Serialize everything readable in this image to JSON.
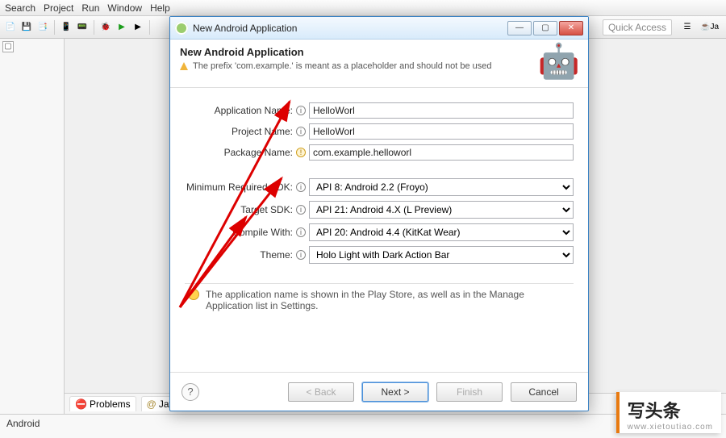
{
  "ide": {
    "menu": [
      "Search",
      "Project",
      "Run",
      "Window",
      "Help"
    ],
    "quick_access": "Quick Access",
    "perspective_label": "Ja",
    "tabs": {
      "problems": "Problems",
      "javadoc": "Javadoc"
    },
    "status": "Android"
  },
  "dialog": {
    "title": "New Android Application",
    "header_title": "New Android Application",
    "header_sub": "The prefix 'com.example.' is meant as a placeholder and should not be used",
    "fields": {
      "app_name_label": "Application Name:",
      "app_name_value": "HelloWorl",
      "project_name_label": "Project Name:",
      "project_name_value": "HelloWorl",
      "package_name_label": "Package Name:",
      "package_name_value": "com.example.helloworl",
      "min_sdk_label": "Minimum Required SDK:",
      "min_sdk_value": "API 8: Android 2.2 (Froyo)",
      "target_sdk_label": "Target SDK:",
      "target_sdk_value": "API 21: Android 4.X (L Preview)",
      "compile_with_label": "Compile With:",
      "compile_with_value": "API 20: Android 4.4 (KitKat Wear)",
      "theme_label": "Theme:",
      "theme_value": "Holo Light with Dark Action Bar"
    },
    "note": "The application name is shown in the Play Store, as well as in the Manage Application list in Settings.",
    "buttons": {
      "back": "< Back",
      "next": "Next >",
      "finish": "Finish",
      "cancel": "Cancel"
    }
  },
  "watermark": {
    "big": "写头条",
    "small": "www.xietoutiao.com"
  }
}
